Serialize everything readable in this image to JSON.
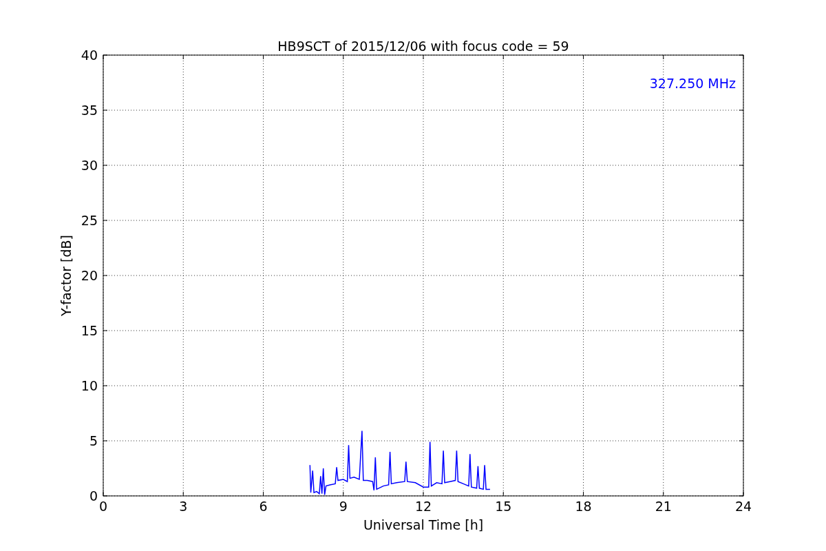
{
  "chart_data": {
    "type": "line",
    "title": "HB9SCT of 2015/12/06 with focus code = 59",
    "xlabel": "Universal Time [h]",
    "ylabel": "Y-factor [dB]",
    "x": [
      7.75,
      7.78,
      7.85,
      7.9,
      8.0,
      8.1,
      8.15,
      8.2,
      8.25,
      8.3,
      8.35,
      8.5,
      8.7,
      8.75,
      8.8,
      9.0,
      9.15,
      9.2,
      9.25,
      9.4,
      9.6,
      9.7,
      9.75,
      9.9,
      10.1,
      10.15,
      10.2,
      10.25,
      10.5,
      10.7,
      10.75,
      10.8,
      11.0,
      11.3,
      11.35,
      11.4,
      11.7,
      12.0,
      12.2,
      12.25,
      12.3,
      12.5,
      12.7,
      12.75,
      12.8,
      13.0,
      13.2,
      13.25,
      13.3,
      13.5,
      13.7,
      13.75,
      13.8,
      14.0,
      14.05,
      14.1,
      14.25,
      14.3,
      14.35,
      14.5
    ],
    "series": [
      {
        "name": "327.250 MHz",
        "color": "#0000ff",
        "values": [
          2.8,
          0.3,
          2.3,
          0.3,
          0.4,
          0.2,
          1.8,
          0.2,
          2.5,
          0.1,
          0.9,
          1.0,
          1.1,
          2.6,
          1.4,
          1.5,
          1.3,
          4.6,
          1.6,
          1.7,
          1.5,
          5.9,
          1.4,
          1.4,
          1.3,
          0.5,
          3.5,
          0.6,
          0.9,
          1.0,
          4.0,
          1.1,
          1.2,
          1.3,
          3.1,
          1.3,
          1.2,
          0.8,
          0.8,
          4.9,
          0.9,
          1.2,
          1.1,
          4.1,
          1.2,
          1.3,
          1.4,
          4.1,
          1.3,
          1.1,
          0.9,
          3.8,
          0.8,
          0.7,
          2.7,
          0.7,
          0.6,
          2.8,
          0.6,
          0.6
        ]
      }
    ],
    "xlim": [
      0,
      24
    ],
    "ylim": [
      0,
      40
    ],
    "xticks": [
      0,
      3,
      6,
      9,
      12,
      15,
      18,
      21,
      24
    ],
    "yticks": [
      0,
      5,
      10,
      15,
      20,
      25,
      30,
      35,
      40
    ],
    "grid": true
  }
}
